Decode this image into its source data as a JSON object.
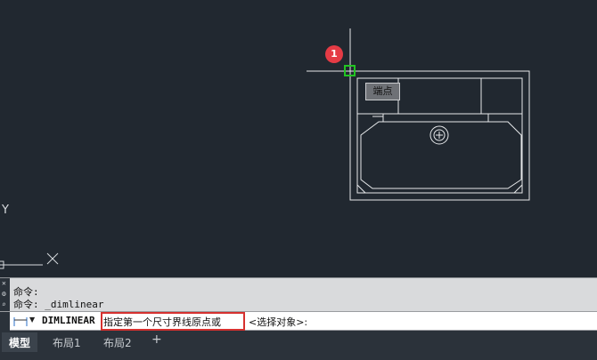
{
  "canvas": {
    "tooltip": "端点",
    "step_badge": "1",
    "ucs_y": "Y",
    "ucs_x": "X"
  },
  "history": {
    "line1": "命令:",
    "line2": "命令: _dimlinear"
  },
  "command_line": {
    "command": "DIMLINEAR",
    "prompt": "指定第一个尺寸界线原点或",
    "option": "<选择对象>:"
  },
  "tabs": [
    {
      "label": "模型",
      "active": true
    },
    {
      "label": "布局1",
      "active": false
    },
    {
      "label": "布局2",
      "active": false
    }
  ],
  "add_tab": "+",
  "colors": {
    "background": "#212830",
    "geometry": "#e6e8ea",
    "snap_marker": "#22c422",
    "highlight": "#d6312f"
  }
}
